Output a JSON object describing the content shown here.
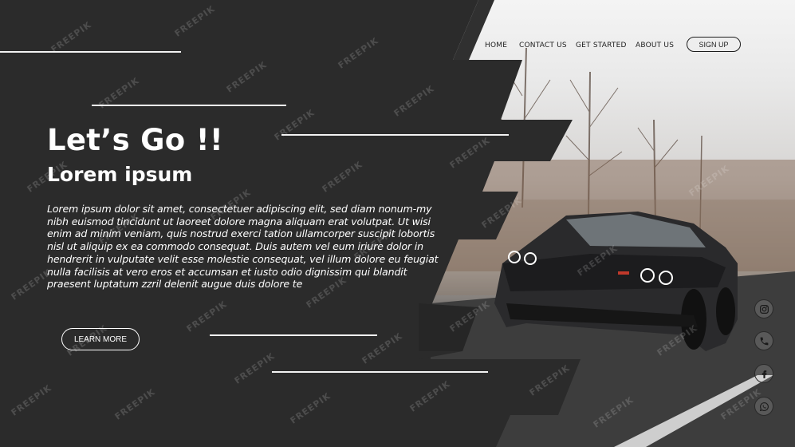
{
  "nav": {
    "items": [
      "HOME",
      "CONTACT US",
      "GET STARTED",
      "ABOUT US"
    ],
    "signup_label": "SIGN UP"
  },
  "hero": {
    "title": "Let’s Go !!",
    "subtitle": "Lorem ipsum",
    "body": "Lorem ipsum dolor sit amet, consectetuer adipiscing elit, sed diam nonum-my nibh euismod tincidunt ut laoreet dolore magna aliquam erat volutpat. Ut wisi enim ad minim veniam, quis nostrud exerci tation ullamcorper suscipit lobortis nisl ut aliquip ex ea commodo consequat. Duis autem vel eum iriure dolor in hendrerit in vulputate velit esse molestie consequat, vel illum dolore eu feugiat nulla facilisis at vero eros et accumsan et iusto odio dignissim qui blandit praesent luptatum zzril delenit augue duis dolore te",
    "learn_more_label": "LEARN MORE"
  },
  "social": [
    "instagram-icon",
    "phone-icon",
    "facebook-icon",
    "whatsapp-icon"
  ],
  "watermark": "FREEPIK",
  "colors": {
    "panel": "#2b2b2b",
    "text_light": "#ffffff",
    "text_dark": "#1d1d1d"
  }
}
